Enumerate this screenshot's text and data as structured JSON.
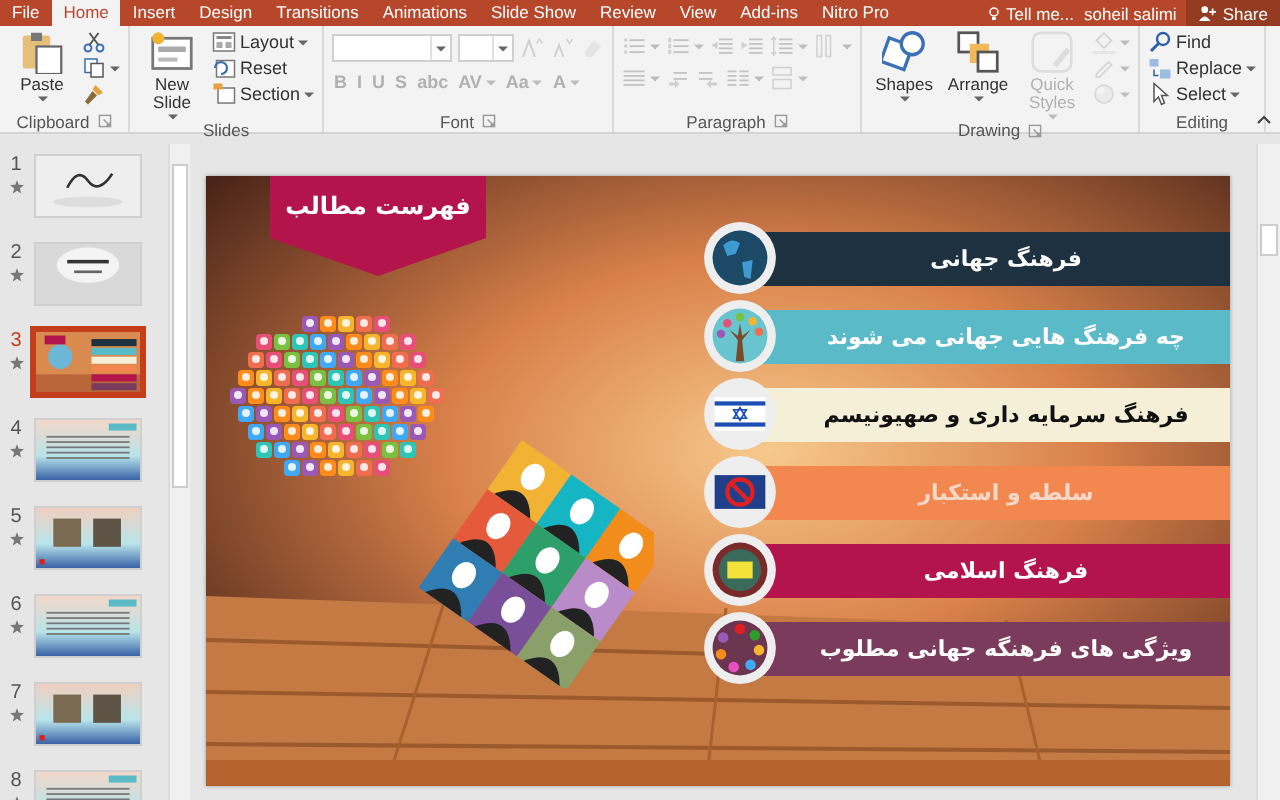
{
  "tabs": [
    {
      "label": "File",
      "selected": false
    },
    {
      "label": "Home",
      "selected": true
    },
    {
      "label": "Insert",
      "selected": false
    },
    {
      "label": "Design",
      "selected": false
    },
    {
      "label": "Transitions",
      "selected": false
    },
    {
      "label": "Animations",
      "selected": false
    },
    {
      "label": "Slide Show",
      "selected": false
    },
    {
      "label": "Review",
      "selected": false
    },
    {
      "label": "View",
      "selected": false
    },
    {
      "label": "Add-ins",
      "selected": false
    },
    {
      "label": "Nitro Pro",
      "selected": false
    }
  ],
  "tell_me": "Tell me...",
  "user": "soheil salimi",
  "share": "Share",
  "ribbon": [
    {
      "label": "Clipboard",
      "launcher": true,
      "kind": "columns",
      "sets": [
        [
          {
            "kind": "large",
            "label": "Paste",
            "caret": true,
            "disabled": false
          }
        ],
        [
          {
            "kind": "icon",
            "caret": false,
            "disabled": false
          },
          {
            "kind": "icon",
            "caret": true,
            "disabled": false
          },
          {
            "kind": "icon",
            "caret": false,
            "disabled": false
          }
        ]
      ]
    },
    {
      "label": "Slides",
      "launcher": false,
      "kind": "columns",
      "sets": [
        [
          {
            "kind": "large",
            "label": "New Slide",
            "caret": true,
            "disabled": false
          }
        ],
        [
          {
            "kind": "small",
            "label": "Layout",
            "caret": true,
            "disabled": false
          },
          {
            "kind": "small",
            "label": "Reset",
            "caret": false,
            "disabled": false
          },
          {
            "kind": "small",
            "label": "Section",
            "caret": true,
            "disabled": false
          }
        ]
      ]
    },
    {
      "label": "Font",
      "launcher": true,
      "kind": "rows",
      "sets": [
        [
          {
            "kind": "fontbox",
            "caret": true,
            "disabled": true
          },
          {
            "kind": "sizebox",
            "caret": true,
            "disabled": true
          },
          {
            "kind": "icon",
            "caret": false,
            "disabled": true
          },
          {
            "kind": "icon",
            "caret": false,
            "disabled": true
          },
          {
            "kind": "icon",
            "caret": false,
            "disabled": true
          }
        ],
        [
          {
            "kind": "glyph",
            "text": "B",
            "caret": false,
            "disabled": true
          },
          {
            "kind": "glyph",
            "text": "I",
            "caret": false,
            "disabled": true
          },
          {
            "kind": "glyph",
            "text": "U",
            "caret": false,
            "disabled": true
          },
          {
            "kind": "glyph",
            "text": "S",
            "caret": false,
            "disabled": true
          },
          {
            "kind": "glyph",
            "text": "abc",
            "caret": false,
            "disabled": true
          },
          {
            "kind": "glyph",
            "text": "AV",
            "caret": true,
            "disabled": true
          },
          {
            "kind": "glyph",
            "text": "Aa",
            "caret": true,
            "disabled": true
          },
          {
            "kind": "glyph",
            "text": "A",
            "caret": true,
            "disabled": true
          }
        ]
      ]
    },
    {
      "label": "Paragraph",
      "launcher": true,
      "kind": "rows",
      "sets": [
        [
          {
            "kind": "icon",
            "caret": true,
            "disabled": true
          },
          {
            "kind": "icon",
            "caret": true,
            "disabled": true
          },
          {
            "kind": "icon",
            "caret": false,
            "disabled": true
          },
          {
            "kind": "icon",
            "caret": false,
            "disabled": true
          },
          {
            "kind": "icon",
            "caret": true,
            "disabled": true
          },
          {
            "kind": "icon",
            "caret": true,
            "disabled": true
          }
        ],
        [
          {
            "kind": "icon",
            "caret": true,
            "disabled": true
          },
          {
            "kind": "icon",
            "caret": false,
            "disabled": true
          },
          {
            "kind": "icon",
            "caret": false,
            "disabled": true
          },
          {
            "kind": "icon",
            "caret": true,
            "disabled": true
          },
          {
            "kind": "icon",
            "caret": true,
            "disabled": true
          }
        ]
      ]
    },
    {
      "label": "Drawing",
      "launcher": true,
      "kind": "columns",
      "sets": [
        [
          {
            "kind": "large",
            "label": "Shapes",
            "caret": true,
            "disabled": false
          }
        ],
        [
          {
            "kind": "large",
            "label": "Arrange",
            "caret": true,
            "disabled": false
          }
        ],
        [
          {
            "kind": "large",
            "label": "Quick Styles",
            "caret": true,
            "disabled": true
          }
        ],
        [
          {
            "kind": "icon",
            "caret": true,
            "disabled": true
          },
          {
            "kind": "icon",
            "caret": true,
            "disabled": true
          },
          {
            "kind": "icon",
            "caret": true,
            "disabled": true
          }
        ]
      ]
    },
    {
      "label": "Editing",
      "launcher": false,
      "kind": "columns",
      "sets": [
        [
          {
            "kind": "small",
            "label": "Find",
            "caret": false,
            "disabled": false
          },
          {
            "kind": "small",
            "label": "Replace",
            "caret": true,
            "disabled": false
          },
          {
            "kind": "small",
            "label": "Select",
            "caret": true,
            "disabled": false
          }
        ]
      ]
    }
  ],
  "slides": [
    {
      "number": "1",
      "selected": false,
      "animated": true,
      "kind": "title"
    },
    {
      "number": "2",
      "selected": false,
      "animated": true,
      "kind": "heading"
    },
    {
      "number": "3",
      "selected": true,
      "animated": true,
      "kind": "contents"
    },
    {
      "number": "4",
      "selected": false,
      "animated": true,
      "kind": "text"
    },
    {
      "number": "5",
      "selected": false,
      "animated": true,
      "kind": "photos"
    },
    {
      "number": "6",
      "selected": false,
      "animated": true,
      "kind": "text"
    },
    {
      "number": "7",
      "selected": false,
      "animated": true,
      "kind": "photos"
    },
    {
      "number": "8",
      "selected": false,
      "animated": true,
      "kind": "text"
    }
  ],
  "slide": {
    "title": "فهرست مطالب",
    "topics": [
      {
        "text": "فرهنگ جهانی",
        "color": "#1d3140"
      },
      {
        "text": "چه فرهنگ هایی جهانی می شوند",
        "color": "#5bbac7"
      },
      {
        "text": "فرهنگ سرمایه داری و صهیونیسم",
        "color": "#f6efd8"
      },
      {
        "text": "سلطه و استکبار",
        "color": "#f2874f"
      },
      {
        "text": "فرهنگ اسلامی",
        "color": "#b3144b"
      },
      {
        "text": "ویژگی های فرهنگه جهانی مطلوب",
        "color": "#7b3b5c"
      }
    ]
  }
}
